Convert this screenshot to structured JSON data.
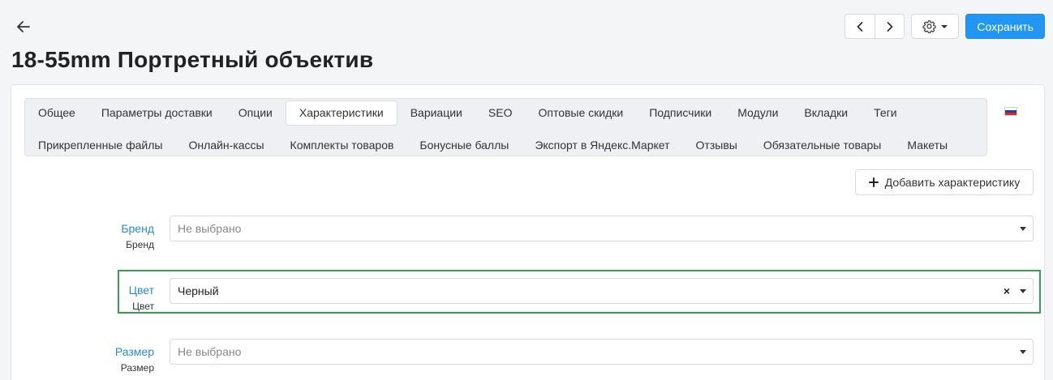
{
  "header": {
    "title": "18-55mm Портретный объектив",
    "save_label": "Сохранить"
  },
  "icons": {
    "back": "arrow-left-icon",
    "prev": "chevron-left-icon",
    "next": "chevron-right-icon",
    "settings": "gear-icon",
    "add": "plus-icon",
    "flag": "russia-flag-icon"
  },
  "tabs": {
    "row1": [
      "Общее",
      "Параметры доставки",
      "Опции",
      "Характеристики",
      "Вариации",
      "SEO",
      "Оптовые скидки",
      "Подписчики",
      "Модули",
      "Вкладки",
      "Теги"
    ],
    "row2": [
      "Прикрепленные файлы",
      "Онлайн-кассы",
      "Комплекты товаров",
      "Бонусные баллы",
      "Экспорт в Яндекс.Маркет",
      "Отзывы",
      "Обязательные товары",
      "Макеты"
    ],
    "active": "Характеристики"
  },
  "add_feature_label": "Добавить характеристику",
  "fields": [
    {
      "label": "Бренд",
      "sublabel": "Бренд",
      "value": "Не выбрано",
      "placeholder": true
    },
    {
      "label": "Цвет",
      "sublabel": "Цвет",
      "value": "Черный",
      "placeholder": false,
      "clear": "×"
    },
    {
      "label": "Размер",
      "sublabel": "Размер",
      "value": "Не выбрано",
      "placeholder": true
    }
  ],
  "colors": {
    "accent": "#2196f3",
    "link": "#2a8ad7",
    "highlight": "#2ea44f"
  }
}
